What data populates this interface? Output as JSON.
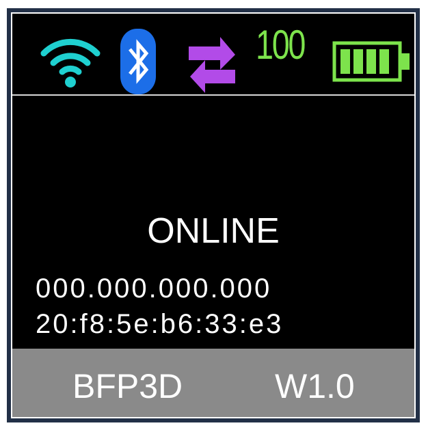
{
  "status_bar": {
    "icons": [
      "wifi-icon",
      "bluetooth-icon",
      "transfer-arrows-icon",
      "battery-icon"
    ],
    "battery_percent": "100",
    "battery_level": 1.0,
    "colors": {
      "wifi": "#1fd0d0",
      "bluetooth": "#1c6ee8",
      "transfer": "#b24be8",
      "battery": "#7de34c"
    }
  },
  "main": {
    "status": "ONLINE",
    "ip_address": "000.000.000.000",
    "mac_address": "20:f8:5e:b6:33:e3"
  },
  "footer": {
    "name": "BFP3D",
    "version": "W1.0",
    "background": "#8a8a8a"
  }
}
